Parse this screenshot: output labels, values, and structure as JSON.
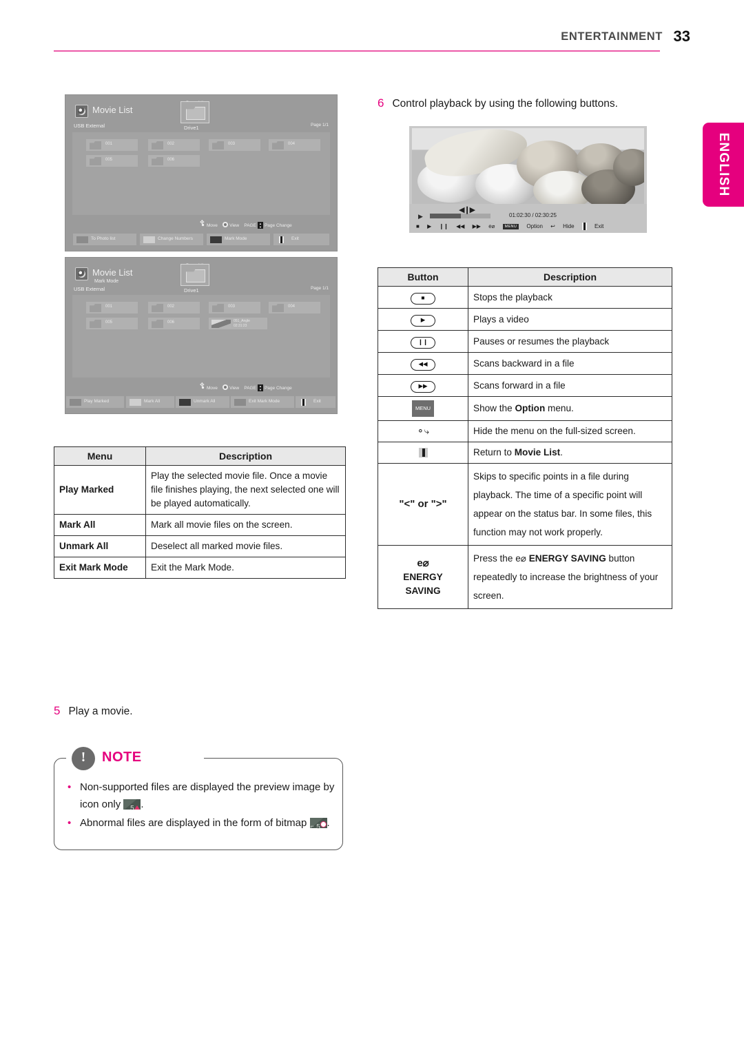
{
  "header": {
    "section": "ENTERTAINMENT",
    "page_number": "33"
  },
  "side_tab": {
    "label": "ENGLISH",
    "color": "#e5007e"
  },
  "steps": {
    "step5": {
      "number": "5",
      "text": "Play a movie."
    },
    "step6": {
      "number": "6",
      "text": "Control playback by using the following buttons."
    }
  },
  "movie_list_screen": {
    "title": "Movie List",
    "source": "USB External",
    "page_top": "Page 1/1",
    "page_right": "Page 1/1",
    "drive_label": "Drive1",
    "items": [
      "001",
      "002",
      "003",
      "004",
      "005",
      "006"
    ],
    "hints": {
      "move": "Move",
      "view": "View",
      "page_key": "PAGE",
      "page_change": "Page Change"
    },
    "buttons": [
      {
        "label": "To Photo list",
        "swatch": "gray"
      },
      {
        "label": "Change Numbers",
        "swatch": "white"
      },
      {
        "label": "Mark Mode",
        "swatch": "black"
      },
      {
        "label": "Exit",
        "swatch": "exit"
      }
    ]
  },
  "mark_mode_screen": {
    "title": "Movie List",
    "subtitle": "Mark Mode",
    "source": "USB External",
    "page_top": "Page 1/1",
    "page_right": "Page 1/1",
    "drive_label": "Drive1",
    "items": [
      "001",
      "002",
      "003",
      "004",
      "005",
      "006"
    ],
    "file_item": {
      "name": "051_Angle",
      "duration": "02:31:23"
    },
    "hints": {
      "move": "Move",
      "view": "View",
      "page_key": "PAGE",
      "page_change": "Page Change"
    },
    "buttons": [
      {
        "label": "Play Marked",
        "swatch": "gray"
      },
      {
        "label": "Mark All",
        "swatch": "white"
      },
      {
        "label": "Unmark All",
        "swatch": "black"
      },
      {
        "label": "Exit Mark Mode",
        "swatch": "gray"
      },
      {
        "label": "Exit",
        "swatch": "exit"
      }
    ]
  },
  "video_player": {
    "time": "01:02:30 / 02:30:25",
    "controls": [
      {
        "name": "stop",
        "glyph": "■"
      },
      {
        "name": "play",
        "glyph": "▶"
      },
      {
        "name": "pause",
        "glyph": "❙❙"
      },
      {
        "name": "rewind",
        "glyph": "◀◀"
      },
      {
        "name": "fast-forward",
        "glyph": "▶▶"
      },
      {
        "name": "energy-saving",
        "glyph": "e⌀"
      }
    ],
    "menu_badge": "MENU",
    "option_label": "Option",
    "hide_label": "Hide",
    "exit_label": "Exit"
  },
  "menu_table": {
    "headers": [
      "Menu",
      "Description"
    ],
    "rows": [
      {
        "menu": "Play Marked",
        "description": "Play the selected movie file. Once a movie file finishes playing, the next selected one will be played automatically."
      },
      {
        "menu": "Mark All",
        "description": "Mark all movie files on the screen."
      },
      {
        "menu": "Unmark All",
        "description": "Deselect all marked movie files."
      },
      {
        "menu": "Exit Mark Mode",
        "description": "Exit the Mark Mode."
      }
    ]
  },
  "button_table": {
    "headers": [
      "Button",
      "Description"
    ],
    "rows": [
      {
        "icon": "stop-button-icon",
        "glyph": "■",
        "description": "Stops the playback"
      },
      {
        "icon": "play-button-icon",
        "glyph": "▶",
        "description": "Plays a video"
      },
      {
        "icon": "pause-button-icon",
        "glyph": "❙❙",
        "description": "Pauses or resumes the playback"
      },
      {
        "icon": "rewind-button-icon",
        "glyph": "◀◀",
        "description": "Scans backward in a file"
      },
      {
        "icon": "forward-button-icon",
        "glyph": "▶▶",
        "description": "Scans forward in a file"
      },
      {
        "icon": "menu-button-icon",
        "glyph": "MENU",
        "description_pre": "Show the ",
        "description_b": "Option",
        "description_post": " menu."
      },
      {
        "icon": "back-button-icon",
        "glyph": "↩",
        "description": "Hide the menu on the full-sized screen."
      },
      {
        "icon": "exit-button-icon",
        "glyph": "",
        "description_pre": "Return to ",
        "description_b": "Movie List",
        "description_post": "."
      },
      {
        "icon": "left-right-arrows-label",
        "glyph": "\"<\" or \">\"",
        "description": "Skips to specific points in a file during playback. The time of a specific point will appear on the status bar. In some files, this function may not work properly."
      },
      {
        "icon": "energy-saving-icon",
        "glyph": "e⌀",
        "label_line1": "ENERGY",
        "label_line2": "SAVING",
        "description_pre": "Press the ",
        "description_leaf": "e⌀",
        "description_b": " ENERGY SAVING",
        "description_post": " button repeatedly to increase the brightness of your screen."
      }
    ]
  },
  "note": {
    "title": "NOTE",
    "items": [
      {
        "text_pre": "Non-supported files are displayed the preview image by icon only ",
        "badge": "5",
        "badge_mark": "triangle",
        "text_post": "."
      },
      {
        "text_pre": "Abnormal files are displayed in the form of bitmap ",
        "badge": "5",
        "badge_mark": "circle",
        "text_post": "."
      }
    ]
  }
}
